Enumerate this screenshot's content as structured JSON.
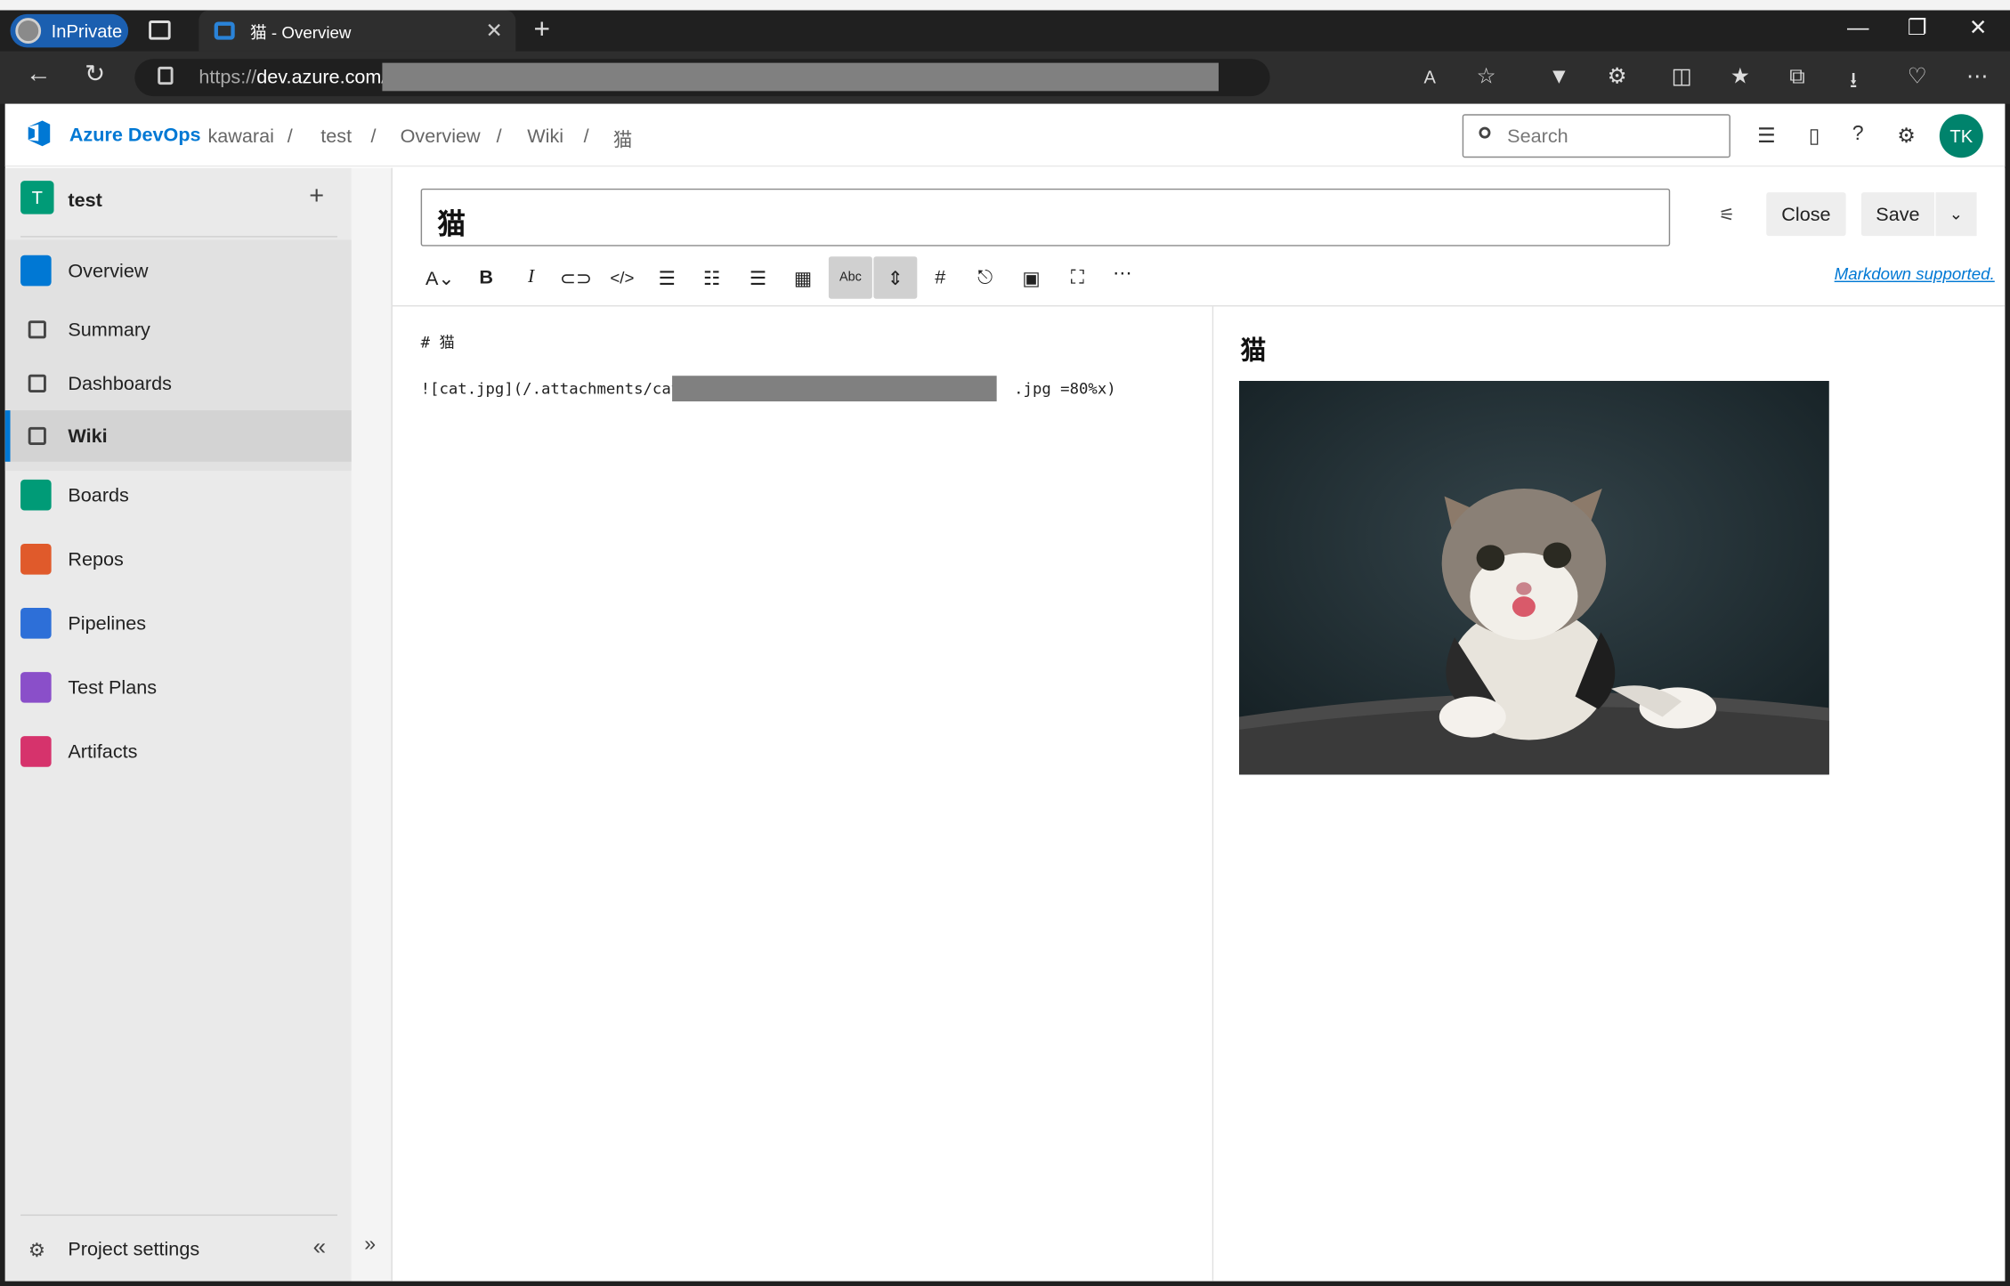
{
  "browser": {
    "inprivate_label": "InPrivate",
    "tab_title": "猫 - Overview",
    "url_scheme": "https://",
    "url_host": "dev.azure.com",
    "url_rest": "/"
  },
  "header": {
    "brand": "Azure DevOps",
    "breadcrumbs": [
      "kawarai",
      "test",
      "Overview",
      "Wiki",
      "猫"
    ],
    "separator": "/",
    "search_placeholder": "Search",
    "avatar_initials": "TK"
  },
  "sidebar": {
    "project_initial": "T",
    "project_name": "test",
    "items": [
      {
        "label": "Overview",
        "icon": "overview-icon",
        "color": "#0078d4"
      },
      {
        "label": "Summary",
        "icon": "summary-icon"
      },
      {
        "label": "Dashboards",
        "icon": "dashboards-icon"
      },
      {
        "label": "Wiki",
        "icon": "wiki-icon"
      },
      {
        "label": "Boards",
        "icon": "boards-icon",
        "color": "#009b77"
      },
      {
        "label": "Repos",
        "icon": "repos-icon",
        "color": "#e05a2b"
      },
      {
        "label": "Pipelines",
        "icon": "pipelines-icon",
        "color": "#2d6fd8"
      },
      {
        "label": "Test Plans",
        "icon": "test-plans-icon",
        "color": "#8a4fc9"
      },
      {
        "label": "Artifacts",
        "icon": "artifacts-icon",
        "color": "#d6336c"
      }
    ],
    "settings_label": "Project settings"
  },
  "editor": {
    "page_title": "猫",
    "close_label": "Close",
    "save_label": "Save",
    "markdown_link": "Markdown supported.",
    "line1": "# 猫",
    "line2_prefix": "![cat.jpg](/.attachments/cat-",
    "line2_suffix": ".jpg =80%x)",
    "preview_heading": "猫",
    "preview_image": "cat.jpg"
  },
  "colors": {
    "accent": "#0078d4",
    "avatar": "#00836c",
    "project": "#009b77"
  }
}
